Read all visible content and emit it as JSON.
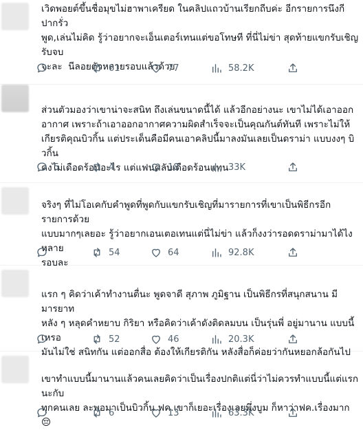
{
  "tweets": [
    {
      "text": "เวิดพอยต์ขึ้นชื่อมุขไม่ฮาพาเครียด ในคลิปแถวบ้านเรียกถีบค่ะ อีกรายการนึงกีปากรั่ว\nพูด,เล่นไม่คิด รู้ว่าอยากจะเอ็นเตอร์เทนแต่ขอโทษที ที่นี่ไม่ข่า สุดท้ายแขกรับเชิญรับจบ\nจะละ  นีลอยตัวหลายรอบแล้วด้วย",
      "replies": "",
      "retweets": "61",
      "likes": "77",
      "views": "58.2K"
    },
    {
      "text": "ส่วนตัวมองว่าเขาน่าจะสนิท ถึงเล่นขนาดนี้ได้ แล้วอีกอย่างนะ เขาไม่ได้เอาออก\nอากาศ เพราะถ้าเอาออกอากาศความผิดสำเร็จจะเป็นคุณกันต์ทันที เพราะไม่ให้\nเกียรติคุณบิวกิ้น แต่ประเด็นคือมีคนเอาคลิปนี้มาลงมันเลยเป็นดราม่า แบบงงๆ บิวกิ้น\nคงไม่เดือดร้อนอะไร แต่แฟนคลับเดือดร้อนแทน",
      "replies": "5",
      "retweets": "4",
      "likes": "18",
      "views": "33K"
    },
    {
      "text": "จริงๆ ที่ไม่โอเคกับคำพูดที่พูดกับแขกรับเชิญที่มารายการที่เขาเป็นพิธีกรอีกรายการด้วย\nแบบมากๆเลยอะ รู้ว่าอยากเอนเตอเทนแต่นี่ไม่ข่า แล้วก็งงว่ารอดดราม่ามาได้ไง หลาย\nรอบละ",
      "replies": "",
      "retweets": "54",
      "likes": "64",
      "views": "92.8K"
    },
    {
      "text": "แรก ๆ คิดว่าเค้าทำงานตื่นะ พูดจาดี สุภาพ ภูมิฐาน เป็นพิธีกรที่สนุกสนาน มีมารยาท\nหลัง ๆ หลุดคำหยาบ กิริยา หรือคิดว่าเค้าดังติดลมบน เป็นรุ่นพี่ อยู่มานาน แบบนี้เหรอ\nมันไม่ใช่ สนิทกัน แต่ออกสื่อ ต้องให้เกียรติกัน หลังสื่อก็ค่อยว่ากันหยอกล้อกันไป",
      "replies": "",
      "retweets": "52",
      "likes": "46",
      "views": "20.3K"
    },
    {
      "text": "เขาทำแบบนี้มานานแล้วคนเลยคิดว่าเป็นเรื่องปกติแต่นี่ว่าไม่ควรทำแบบนี้แต่แรกนะกับ\nทุกคนเลย ละพอมาเป็นบิวกิ้น ฟค.เขาก็เยอะเรื่องเลยพึ่งบูม ก็หาว่าฟค.เรื่องมาก😔",
      "replies": "",
      "retweets": "6",
      "likes": "13",
      "views": "63.3K"
    }
  ]
}
